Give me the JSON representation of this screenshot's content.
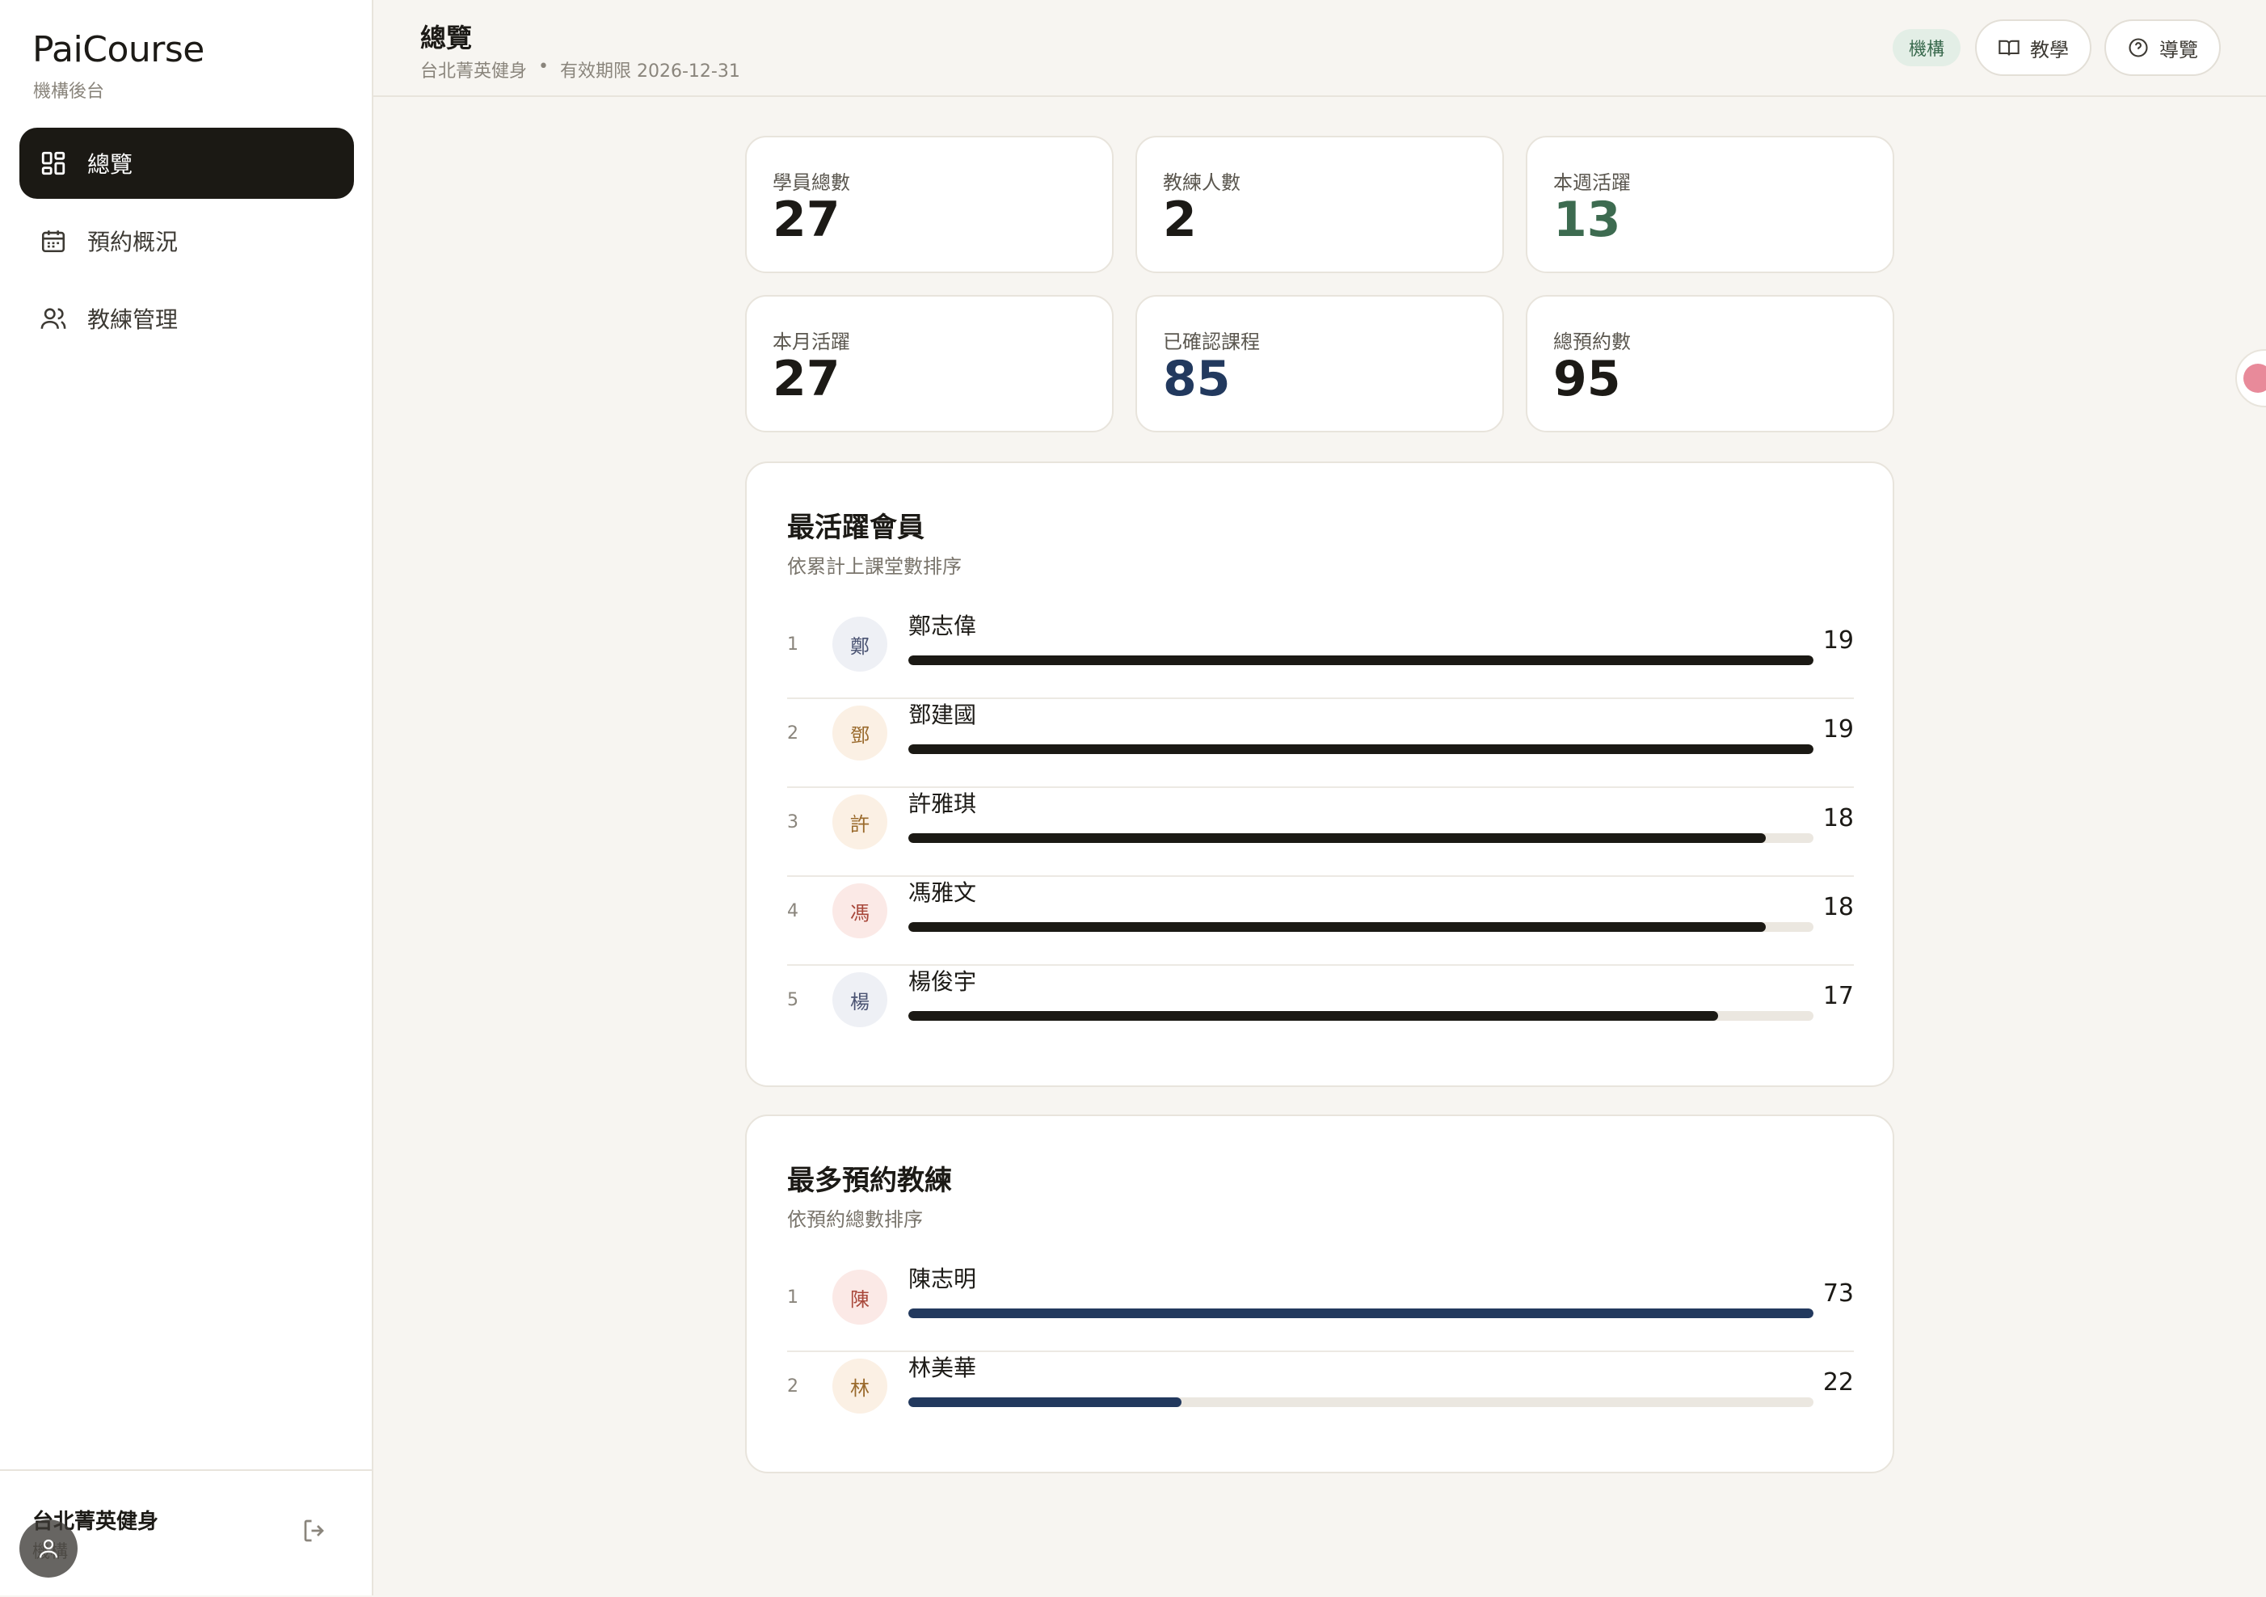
{
  "sidebar": {
    "brand": "PaiCourse",
    "brand_sub": "機構後台",
    "nav": [
      {
        "label": "總覽",
        "icon": "dashboard-icon",
        "active": true
      },
      {
        "label": "預約概況",
        "icon": "calendar-icon",
        "active": false
      },
      {
        "label": "教練管理",
        "icon": "users-icon",
        "active": false
      }
    ],
    "footer": {
      "org_name": "台北菁英健身",
      "role": "機構",
      "logout_icon": "logout-icon"
    }
  },
  "header": {
    "title": "總覽",
    "org": "台北菁英健身",
    "separator": "•",
    "validity": "有效期限 2026-12-31",
    "badge": "機構",
    "buttons": [
      {
        "label": "教學",
        "icon": "book-icon"
      },
      {
        "label": "導覽",
        "icon": "help-circle-icon"
      }
    ]
  },
  "stats": [
    {
      "label": "學員總數",
      "value": "27",
      "color": "#1c1a16"
    },
    {
      "label": "教練人數",
      "value": "2",
      "color": "#1c1a16"
    },
    {
      "label": "本週活躍",
      "value": "13",
      "color": "#3d6b50"
    },
    {
      "label": "本月活躍",
      "value": "27",
      "color": "#1c1a16"
    },
    {
      "label": "已確認課程",
      "value": "85",
      "color": "#22395e"
    },
    {
      "label": "總預約數",
      "value": "95",
      "color": "#1c1a16"
    }
  ],
  "active_members": {
    "title": "最活躍會員",
    "subtitle": "依累計上課堂數排序",
    "bar_color": "#1b1914",
    "items": [
      {
        "rank": "1",
        "initial": "鄭",
        "name": "鄭志偉",
        "value": "19",
        "avatar_bg": "#eef0f5",
        "avatar_fg": "#4a5372"
      },
      {
        "rank": "2",
        "initial": "鄧",
        "name": "鄧建國",
        "value": "19",
        "avatar_bg": "#fbf0e4",
        "avatar_fg": "#9a6a2c"
      },
      {
        "rank": "3",
        "initial": "許",
        "name": "許雅琪",
        "value": "18",
        "avatar_bg": "#fbf0e4",
        "avatar_fg": "#9a6a2c"
      },
      {
        "rank": "4",
        "initial": "馮",
        "name": "馮雅文",
        "value": "18",
        "avatar_bg": "#fbe9e6",
        "avatar_fg": "#a8473a"
      },
      {
        "rank": "5",
        "initial": "楊",
        "name": "楊俊宇",
        "value": "17",
        "avatar_bg": "#eef0f5",
        "avatar_fg": "#4a5372"
      }
    ]
  },
  "top_coaches": {
    "title": "最多預約教練",
    "subtitle": "依預約總數排序",
    "bar_color": "#22395e",
    "items": [
      {
        "rank": "1",
        "initial": "陳",
        "name": "陳志明",
        "value": "73",
        "avatar_bg": "#fbe9e6",
        "avatar_fg": "#a8473a"
      },
      {
        "rank": "2",
        "initial": "林",
        "name": "林美華",
        "value": "22",
        "avatar_bg": "#fbf0e4",
        "avatar_fg": "#9a6a2c"
      }
    ]
  }
}
